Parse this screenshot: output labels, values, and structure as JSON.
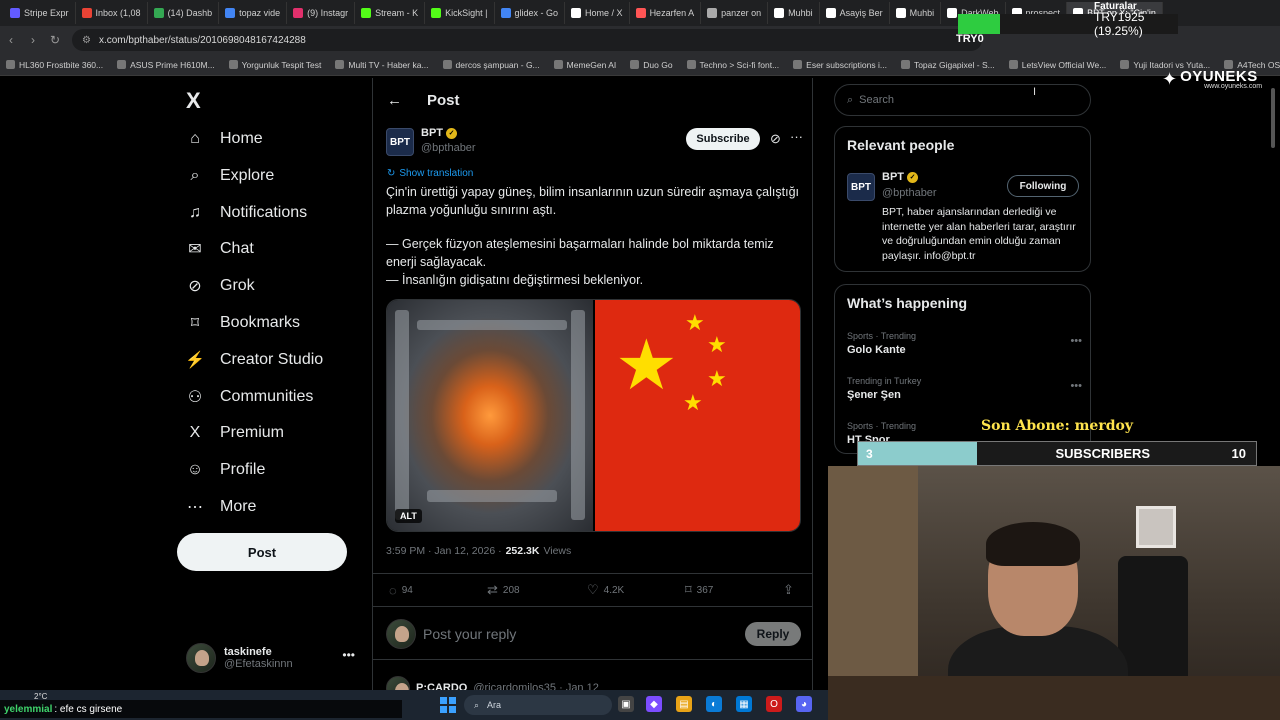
{
  "browser": {
    "tabs": [
      {
        "label": "Stripe Expr",
        "color": "#635bff"
      },
      {
        "label": "Inbox (1,08",
        "color": "#ea4335"
      },
      {
        "label": "(14) Dashb",
        "color": "#34a853"
      },
      {
        "label": "topaz vide",
        "color": "#4285f4"
      },
      {
        "label": "(9) Instagr",
        "color": "#e1306c"
      },
      {
        "label": "Stream - K",
        "color": "#53fc18"
      },
      {
        "label": "KickSight |",
        "color": "#53fc18"
      },
      {
        "label": "glidex - Go",
        "color": "#4285f4"
      },
      {
        "label": "Home / X",
        "color": "#ffffff"
      },
      {
        "label": "Hezarfen A",
        "color": "#ff5555"
      },
      {
        "label": "panzer on",
        "color": "#aaaaaa"
      },
      {
        "label": "Muhbi",
        "color": "#ffffff"
      },
      {
        "label": "Asayiş Ber",
        "color": "#ffffff"
      },
      {
        "label": "Muhbi",
        "color": "#ffffff"
      },
      {
        "label": "DarkWeb",
        "color": "#ffffff"
      },
      {
        "label": "prospect",
        "color": "#ffffff"
      },
      {
        "label": "BPT on X: \"Çin'in",
        "color": "#ffffff",
        "active": true
      }
    ],
    "url": "x.com/bpthaber/status/2010698048167424288",
    "bookmarks": [
      "HL360 Frostbite 360...",
      "ASUS Prime H610M...",
      "Yorgunluk Tespit Test",
      "Multi TV - Haber ka...",
      "dercos şampuan - G...",
      "MemeGen AI",
      "Duo Go",
      "Techno > Sci-fi font...",
      "Eser subscriptions i...",
      "Topaz Gigapixel - S...",
      "LetsView Official We...",
      "Yuji Itadori vs Yuta...",
      "A4Tech OS Fsyle..."
    ]
  },
  "stream_overlay": {
    "try_label": "TRY1925 (19.25%)",
    "try_progress": 0.1925,
    "try_short": "TRY0",
    "faturalar": "Faturalar",
    "try_tag": "TRY100k",
    "brand": "OYUNEKS",
    "brand_site": "www.oyuneks.com",
    "last_sub": "Son Abone: merdoy",
    "sub_current": "3",
    "sub_label": "SUBSCRIBERS",
    "sub_goal": "10",
    "sub_progress": 0.3,
    "chat_user": "yelemmial",
    "chat_msg": ": efe cs girsene",
    "weather": "2°C"
  },
  "sidebar": {
    "logo": "X",
    "items": [
      {
        "label": "Home",
        "icon": "home-icon"
      },
      {
        "label": "Explore",
        "icon": "search-icon"
      },
      {
        "label": "Notifications",
        "icon": "bell-icon"
      },
      {
        "label": "Chat",
        "icon": "mail-icon"
      },
      {
        "label": "Grok",
        "icon": "grok-icon"
      },
      {
        "label": "Bookmarks",
        "icon": "bookmark-icon"
      },
      {
        "label": "Creator Studio",
        "icon": "creator-icon"
      },
      {
        "label": "Communities",
        "icon": "communities-icon"
      },
      {
        "label": "Premium",
        "icon": "x-premium-icon"
      },
      {
        "label": "Profile",
        "icon": "profile-icon"
      },
      {
        "label": "More",
        "icon": "more-circle-icon"
      }
    ],
    "post_label": "Post",
    "account": {
      "display_name": "taskinefe",
      "handle": "@Efetaskinnn"
    }
  },
  "main": {
    "header_title": "Post",
    "author": {
      "name": "BPT",
      "handle": "@bpthaber",
      "logo_text": "BPT"
    },
    "subscribe_label": "Subscribe",
    "show_translation": "Show translation",
    "text": {
      "p1": "Çin'in ürettiği yapay güneş, bilim insanlarının uzun süredir aşmaya çalıştığı plazma yoğunluğu sınırını aştı.",
      "p2": "— Gerçek füzyon ateşlemesini başarmaları halinde bol miktarda temiz enerji sağlayacak.",
      "p3": "— İnsanlığın gidişatını değiştirmesi bekleniyor."
    },
    "media_alt_badge": "ALT",
    "timestamp": "3:59 PM · Jan 12, 2026 ·",
    "views_count": "252.3K",
    "views_label": "Views",
    "stats": {
      "replies": "94",
      "reposts": "208",
      "likes": "4.2K",
      "bookmarks": "367"
    },
    "reply_placeholder": "Post your reply",
    "reply_button": "Reply",
    "next_reply": {
      "name": "P:CARDO",
      "handle": "@ricardomilos35 · Jan 12"
    }
  },
  "right": {
    "search_placeholder": "Search",
    "relevant_title": "Relevant people",
    "relevant": {
      "name": "BPT",
      "handle": "@bpthaber",
      "button": "Following",
      "bio": "BPT, haber ajanslarından derlediği ve internette yer alan haberleri tarar, araştırır ve doğruluğundan emin olduğu zaman paylaşır. info@bpt.tr"
    },
    "happening_title": "What’s happening",
    "trends": [
      {
        "meta": "Sports · Trending",
        "name": "Golo Kante"
      },
      {
        "meta": "Trending in Turkey",
        "name": "Şener Şen"
      },
      {
        "meta": "Sports · Trending",
        "name": "HT Spor"
      }
    ]
  },
  "taskbar": {
    "search_label": "Ara"
  }
}
